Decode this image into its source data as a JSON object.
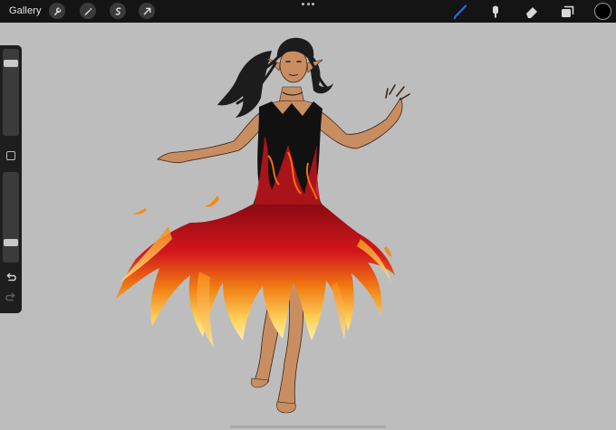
{
  "topbar": {
    "gallery_label": "Gallery",
    "left_tools": [
      "wrench-icon",
      "magic-wand-icon",
      "selection-icon",
      "transform-arrow-icon"
    ],
    "right_tools": [
      "brush-icon",
      "smudge-icon",
      "eraser-icon",
      "layers-icon"
    ],
    "active_tool": "brush-icon",
    "accent_color": "#2f6bff",
    "current_color": "#000000"
  },
  "sidebar": {
    "brush_size_level": 0.86,
    "opacity_level": 0.2
  },
  "colors": {
    "canvas_bg": "#bdbdbd",
    "skin": "#c88e62",
    "hair": "#1c1c1c",
    "dress_top": "#111111",
    "flame_red": "#c4141c",
    "flame_orange": "#f08a12",
    "flame_yellow": "#ffe070"
  }
}
